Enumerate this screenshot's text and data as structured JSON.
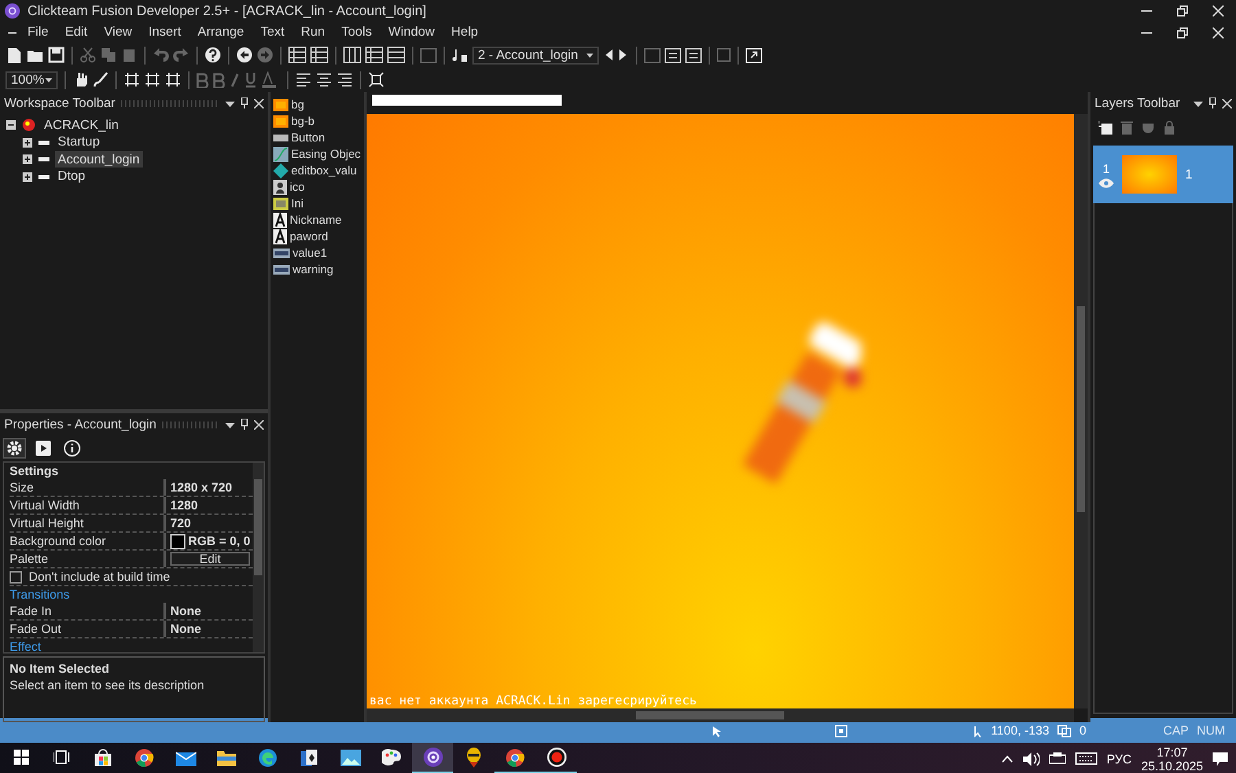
{
  "window": {
    "title": "Clickteam Fusion Developer 2.5+ - [ACRACK_lin - Account_login]"
  },
  "menu": [
    "File",
    "Edit",
    "View",
    "Insert",
    "Arrange",
    "Text",
    "Run",
    "Tools",
    "Window",
    "Help"
  ],
  "toolbar": {
    "frame_select": "2 - Account_login",
    "zoom": "100%"
  },
  "workspace": {
    "title": "Workspace Toolbar",
    "tree": [
      {
        "label": "ACRACK_lin",
        "expanded": true,
        "selected": false,
        "children": [
          {
            "label": "Startup",
            "expanded": false,
            "selected": false
          },
          {
            "label": "Account_login",
            "expanded": false,
            "selected": true
          },
          {
            "label": "Dtop",
            "expanded": false,
            "selected": false
          }
        ]
      }
    ]
  },
  "objects": [
    {
      "label": "bg",
      "kind": "active"
    },
    {
      "label": "bg-b",
      "kind": "active"
    },
    {
      "label": "Button",
      "kind": "button"
    },
    {
      "label": "Easing Objec",
      "kind": "easing"
    },
    {
      "label": "editbox_valu",
      "kind": "editbox"
    },
    {
      "label": "ico",
      "kind": "ico"
    },
    {
      "label": "Ini",
      "kind": "ini"
    },
    {
      "label": "Nickname",
      "kind": "string"
    },
    {
      "label": "paword",
      "kind": "string"
    },
    {
      "label": "value1",
      "kind": "counter"
    },
    {
      "label": "warning",
      "kind": "counter"
    }
  ],
  "properties": {
    "title": "Properties - Account_login",
    "tabs": [
      {
        "kind": "settings",
        "selected": true
      },
      {
        "kind": "runtime",
        "selected": false
      },
      {
        "kind": "about",
        "selected": false
      }
    ],
    "rows": [
      {
        "kind": "section",
        "label": "Settings"
      },
      {
        "kind": "prop",
        "label": "Size",
        "value": "1280 x 720"
      },
      {
        "kind": "prop",
        "label": "Virtual Width",
        "value": "1280"
      },
      {
        "kind": "prop",
        "label": "Virtual Height",
        "value": "720"
      },
      {
        "kind": "color",
        "label": "Background color",
        "value": "RGB = 0, 0",
        "color": "#000000"
      },
      {
        "kind": "button",
        "label": "Palette",
        "value": "Edit"
      },
      {
        "kind": "checkbox",
        "label": "Don't include at build time",
        "checked": false
      },
      {
        "kind": "section",
        "label": "Transitions"
      },
      {
        "kind": "prop",
        "label": "Fade In",
        "value": "None"
      },
      {
        "kind": "prop",
        "label": "Fade Out",
        "value": "None"
      },
      {
        "kind": "section",
        "label": "Effect"
      }
    ],
    "description": {
      "title": "No Item Selected",
      "text": "Select an item to see its description"
    }
  },
  "editor": {
    "canvas_text": "вас нет аккаунта ACRACK.Lin зарегесрируйтесь"
  },
  "layers": {
    "title": "Layers Toolbar",
    "items": [
      {
        "number": "1",
        "count": "1",
        "visible": true,
        "selected": true
      }
    ]
  },
  "status_bar": {
    "coords": "1100, -133",
    "count": "0",
    "keys": [
      {
        "label": "CAP",
        "on": false
      },
      {
        "label": "NUM",
        "on": false
      }
    ]
  },
  "taskbar": {
    "apps": [
      {
        "kind": "store",
        "open": false,
        "selected": false
      },
      {
        "kind": "chrome",
        "open": false,
        "selected": false
      },
      {
        "kind": "mail",
        "open": false,
        "selected": false
      },
      {
        "kind": "folder",
        "open": false,
        "selected": false
      },
      {
        "kind": "edge",
        "open": false,
        "selected": false
      },
      {
        "kind": "cards",
        "open": false,
        "selected": false
      },
      {
        "kind": "photos",
        "open": false,
        "selected": false
      },
      {
        "kind": "paint",
        "open": false,
        "selected": false
      },
      {
        "kind": "fusion",
        "open": true,
        "selected": true
      },
      {
        "kind": "character",
        "open": false,
        "selected": false
      },
      {
        "kind": "chrome",
        "open": true,
        "selected": false
      },
      {
        "kind": "record",
        "open": true,
        "selected": false
      }
    ],
    "language": "РУС",
    "time": "17:07",
    "date": "25.10.2025"
  }
}
